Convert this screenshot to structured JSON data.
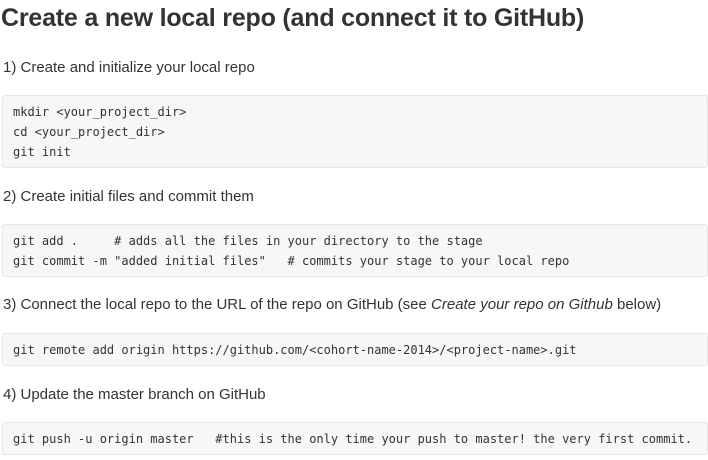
{
  "title": "Create a new local repo (and connect it to GitHub)",
  "steps": [
    {
      "label": "1) Create and initialize your local repo",
      "code": [
        "mkdir <your_project_dir>",
        "cd <your_project_dir>",
        "git init"
      ]
    },
    {
      "label": "2) Create initial files and commit them",
      "code": [
        "git add .     # adds all the files in your directory to the stage",
        "git commit -m \"added initial files\"   # commits your stage to your local repo"
      ]
    },
    {
      "label_before": "3) Connect the local repo to the URL of the repo on GitHub (see ",
      "label_emphasis": "Create your repo on Github",
      "label_after": " below)",
      "code": [
        "git remote add origin https://github.com/<cohort-name-2014>/<project-name>.git"
      ]
    },
    {
      "label": "4) Update the master branch on GitHub",
      "code": [
        "git push -u origin master   #this is the only time your push to master! the very first commit."
      ]
    }
  ]
}
